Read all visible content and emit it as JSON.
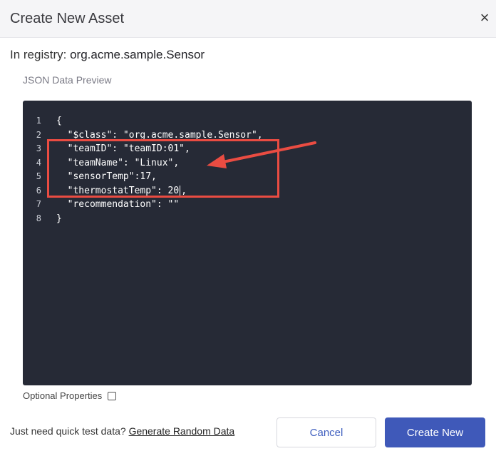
{
  "dialog": {
    "title": "Create New Asset",
    "close_glyph": "×"
  },
  "registry": {
    "prefix": "In registry:",
    "name": "org.acme.sample.Sensor"
  },
  "preview": {
    "label": "JSON Data Preview"
  },
  "editor": {
    "line_numbers": [
      "1",
      "2",
      "3",
      "4",
      "5",
      "6",
      "7",
      "8"
    ],
    "lines": [
      "{",
      "  \"$class\": \"org.acme.sample.Sensor\",",
      "  \"teamID\": \"teamID:01\",",
      "  \"teamName\": \"Linux\",",
      "  \"sensorTemp\":17,",
      "  \"thermostatTemp\": 20",
      "  \"recommendation\": \"\"",
      "}"
    ],
    "line6_after_caret": ","
  },
  "annotation": {
    "color": "#ea4c42"
  },
  "optional": {
    "label": "Optional Properties",
    "checked": false
  },
  "footer": {
    "prompt": "Just need quick test data?",
    "link": "Generate Random Data",
    "cancel_label": "Cancel",
    "create_label": "Create New"
  },
  "colors": {
    "primary": "#3f59b9",
    "editor_bg": "#262a36",
    "header_bg": "#f5f5f7"
  }
}
